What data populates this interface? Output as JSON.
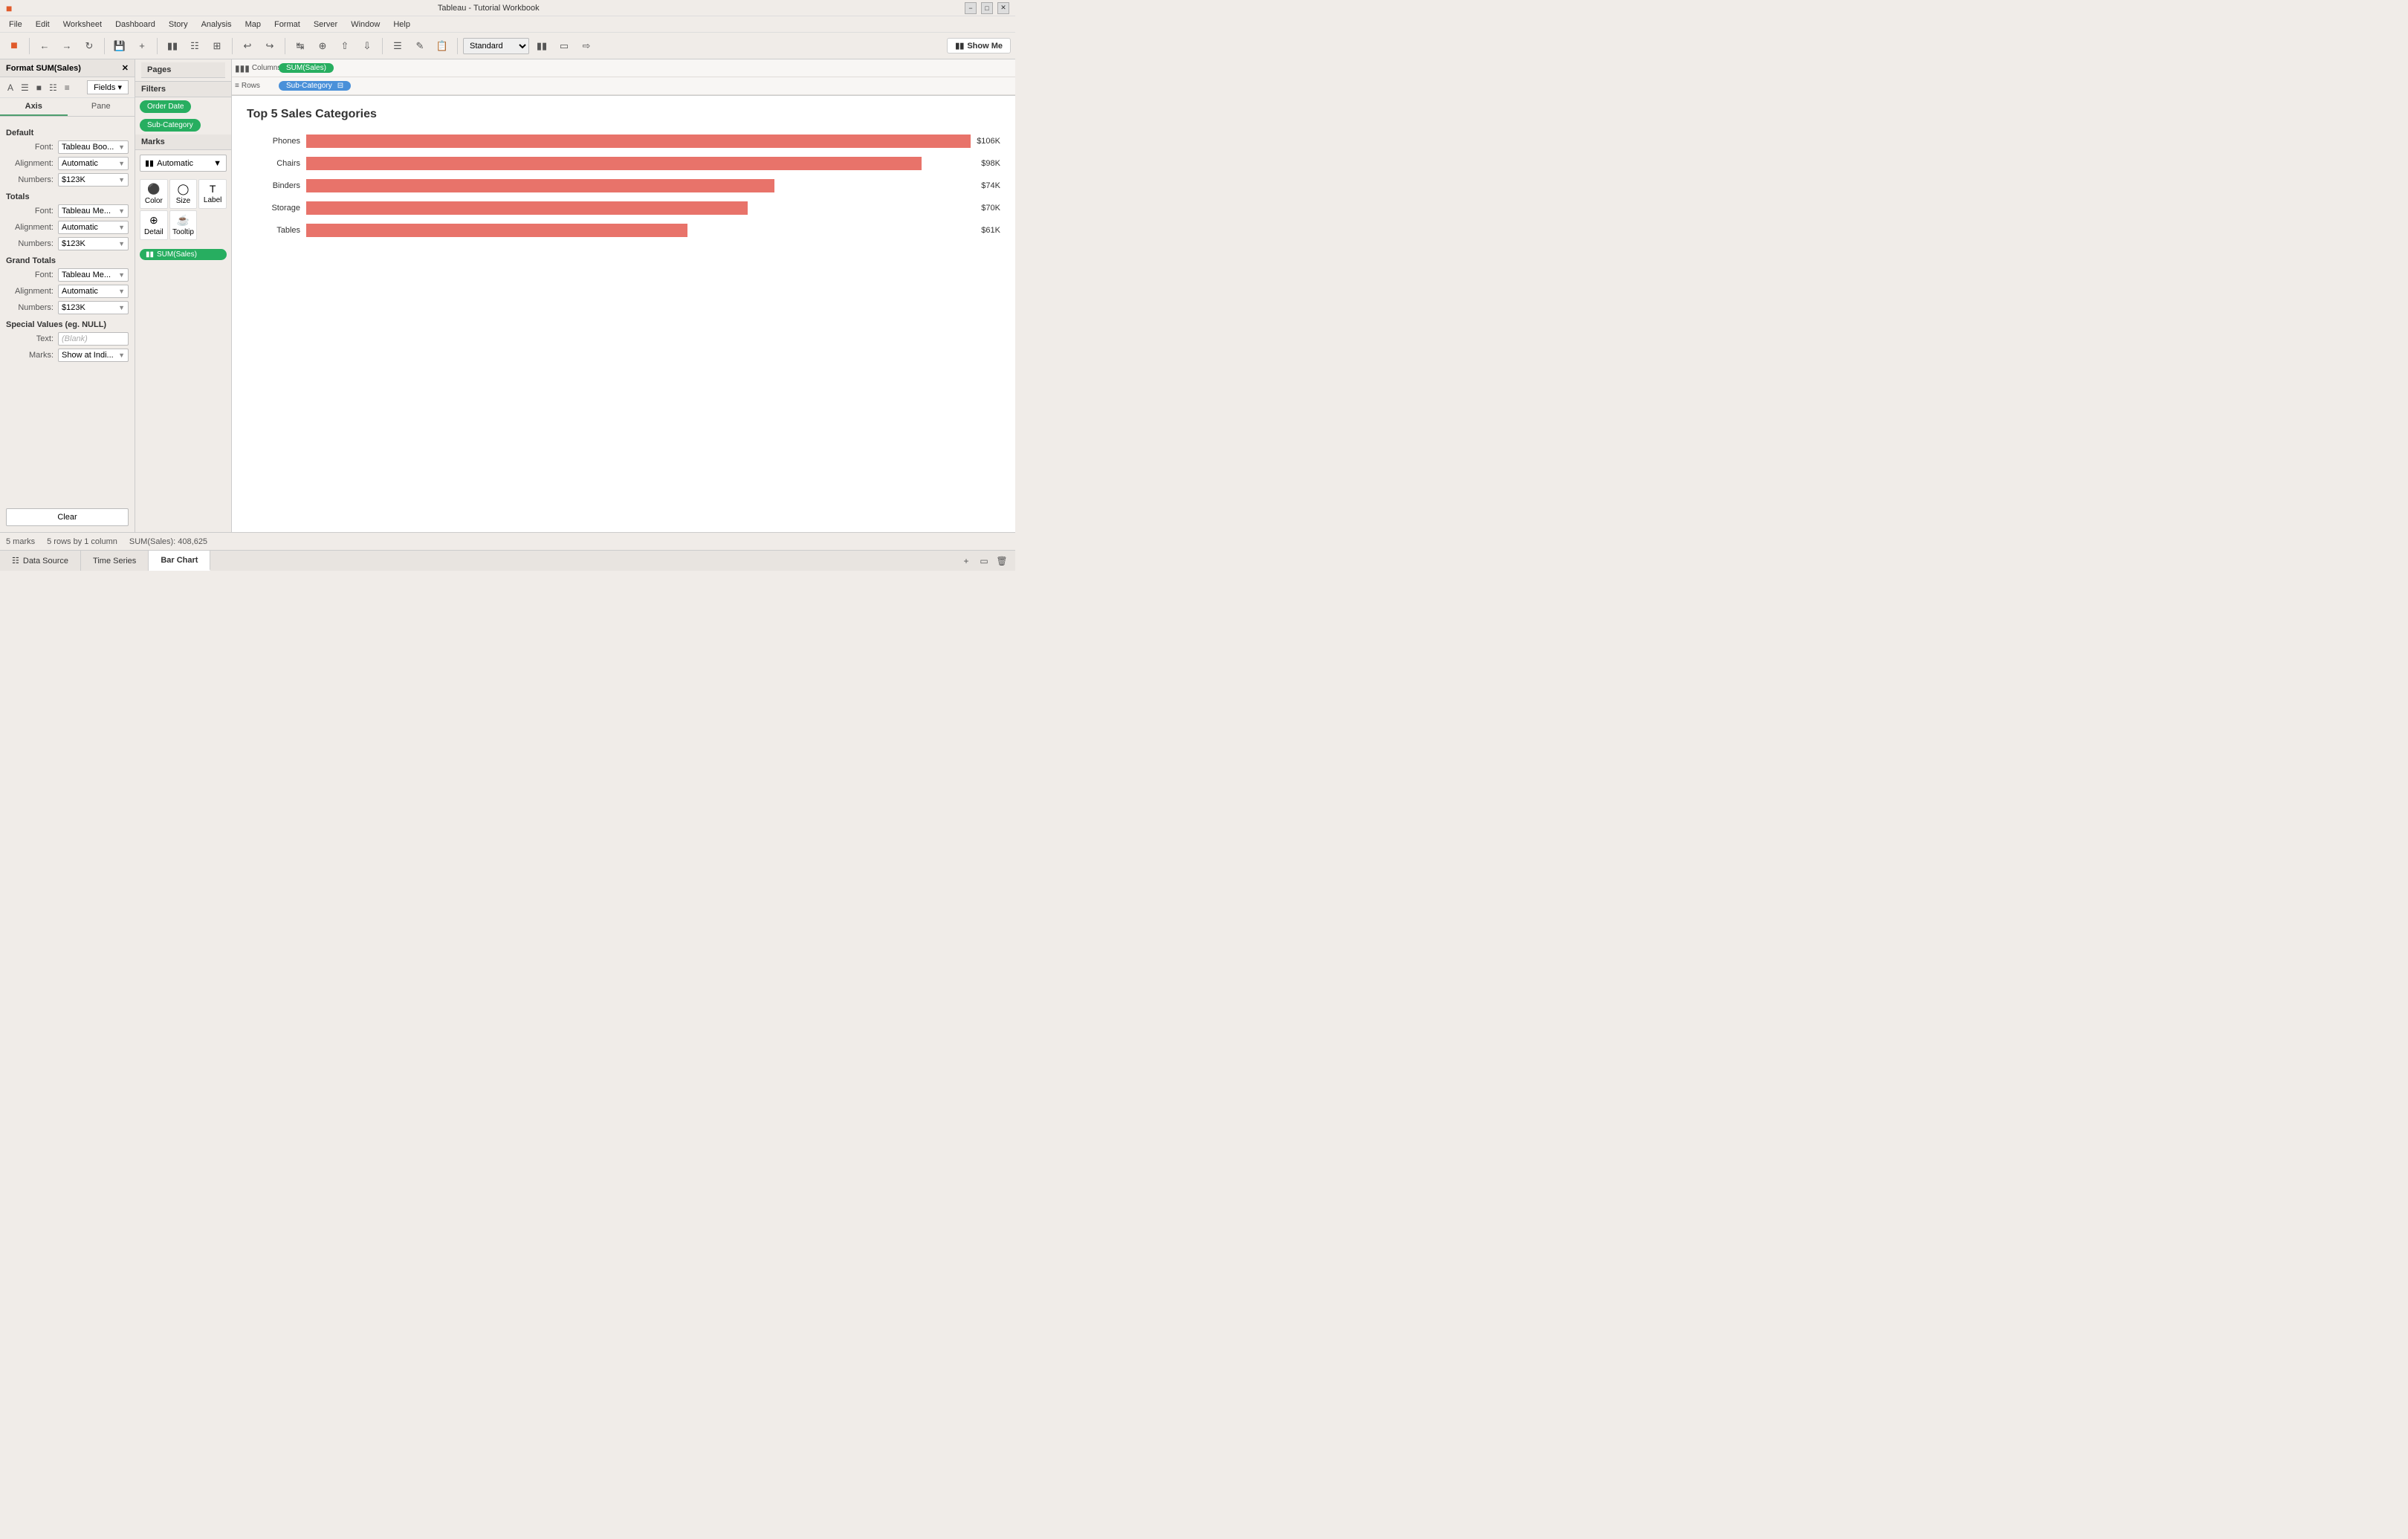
{
  "titlebar": {
    "title": "Tableau - Tutorial Workbook",
    "minimize": "−",
    "maximize": "□",
    "close": "✕"
  },
  "menubar": {
    "items": [
      "File",
      "Edit",
      "Worksheet",
      "Dashboard",
      "Story",
      "Analysis",
      "Map",
      "Format",
      "Server",
      "Window",
      "Help"
    ]
  },
  "toolbar": {
    "show_me_label": "Show Me",
    "standard_label": "Standard"
  },
  "format_panel": {
    "title": "Format SUM(Sales)",
    "close_icon": "✕",
    "icons": [
      "A",
      "≡",
      "⊞",
      "≈",
      "≡"
    ],
    "fields_label": "Fields ▾",
    "tabs": [
      "Axis",
      "Pane"
    ],
    "active_tab": "Axis",
    "sections": {
      "default": {
        "title": "Default",
        "font_label": "Font:",
        "font_value": "Tableau Boo...",
        "alignment_label": "Alignment:",
        "alignment_value": "Automatic",
        "numbers_label": "Numbers:",
        "numbers_value": "$123K"
      },
      "totals": {
        "title": "Totals",
        "font_label": "Font:",
        "font_value": "Tableau Me...",
        "alignment_label": "Alignment:",
        "alignment_value": "Automatic",
        "numbers_label": "Numbers:",
        "numbers_value": "$123K"
      },
      "grand_totals": {
        "title": "Grand Totals",
        "font_label": "Font:",
        "font_value": "Tableau Me...",
        "alignment_label": "Alignment:",
        "alignment_value": "Automatic",
        "numbers_label": "Numbers:",
        "numbers_value": "$123K"
      },
      "special_values": {
        "title": "Special Values (eg. NULL)",
        "text_label": "Text:",
        "text_value": "(Blank)",
        "marks_label": "Marks:",
        "marks_value": "Show at Indi..."
      }
    },
    "clear_label": "Clear"
  },
  "pages": {
    "label": "Pages"
  },
  "filters": {
    "label": "Filters",
    "pills": [
      "Order Date",
      "Sub-Category"
    ]
  },
  "marks": {
    "label": "Marks",
    "type": "Automatic",
    "buttons": [
      {
        "label": "Color",
        "icon": "⬤"
      },
      {
        "label": "Size",
        "icon": "◉"
      },
      {
        "label": "Label",
        "icon": "T"
      },
      {
        "label": "Detail",
        "icon": "⊕"
      },
      {
        "label": "Tooltip",
        "icon": "💬"
      }
    ],
    "pill": "SUM(Sales)"
  },
  "shelves": {
    "columns_label": "Columns",
    "columns_icon": "|||",
    "rows_label": "Rows",
    "rows_icon": "≡",
    "columns_pill": "SUM(Sales)",
    "rows_pill": "Sub-Category",
    "rows_filter_icon": "⊟"
  },
  "chart": {
    "title": "Top 5 Sales Categories",
    "bars": [
      {
        "label": "Phones",
        "value": "$106K",
        "pct": 100
      },
      {
        "label": "Chairs",
        "value": "$98K",
        "pct": 92
      },
      {
        "label": "Binders",
        "value": "$74K",
        "pct": 70
      },
      {
        "label": "Storage",
        "value": "$70K",
        "pct": 66
      },
      {
        "label": "Tables",
        "value": "$61K",
        "pct": 57
      }
    ]
  },
  "status_bar": {
    "marks": "5 marks",
    "rows": "5 rows by 1 column",
    "sum": "SUM(Sales): 408,625"
  },
  "bottom_tabs": {
    "tabs": [
      {
        "label": "Data Source",
        "icon": "⊞",
        "active": false
      },
      {
        "label": "Time Series",
        "icon": "",
        "active": false
      },
      {
        "label": "Bar Chart",
        "icon": "",
        "active": true
      }
    ],
    "add_icon": "⊞",
    "duplicate_icon": "⧉",
    "delete_icon": "✕"
  }
}
